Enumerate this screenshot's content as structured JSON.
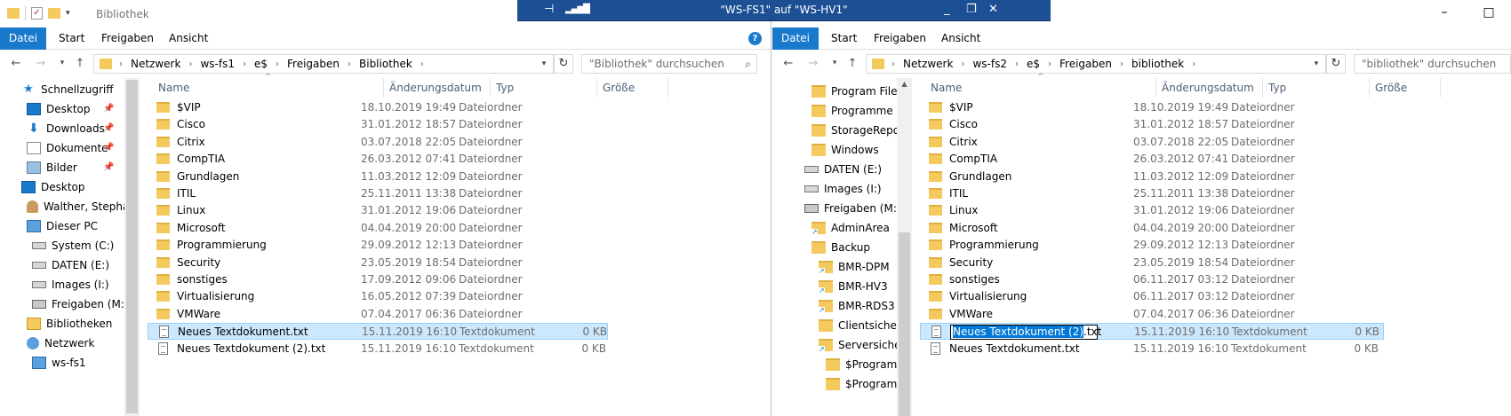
{
  "rdp_bar": {
    "title": "\"WS-FS1\" auf \"WS-HV1\""
  },
  "left": {
    "title": "Bibliothek",
    "ribbon": [
      "Datei",
      "Start",
      "Freigaben",
      "Ansicht"
    ],
    "breadcrumb": [
      "Netzwerk",
      "ws-fs1",
      "e$",
      "Freigaben",
      "Bibliothek"
    ],
    "search_placeholder": "\"Bibliothek\" durchsuchen",
    "columns": [
      "Name",
      "Änderungsdatum",
      "Typ",
      "Größe"
    ],
    "nav": [
      {
        "label": "Schnellzugriff",
        "icon": "star-icon"
      },
      {
        "label": "Desktop",
        "icon": "desktop-icon",
        "pinned": true
      },
      {
        "label": "Downloads",
        "icon": "download-icon",
        "pinned": true
      },
      {
        "label": "Dokumente",
        "icon": "documents-icon",
        "pinned": true
      },
      {
        "label": "Bilder",
        "icon": "pictures-icon",
        "pinned": true
      },
      {
        "label": "Desktop",
        "icon": "desktop-icon"
      },
      {
        "label": "Walther, Stephan",
        "icon": "user-icon"
      },
      {
        "label": "Dieser PC",
        "icon": "computer-icon"
      },
      {
        "label": "System (C:)",
        "icon": "drive-icon"
      },
      {
        "label": "DATEN (E:)",
        "icon": "drive-icon"
      },
      {
        "label": "Images (I:)",
        "icon": "drive-icon"
      },
      {
        "label": "Freigaben (M:)",
        "icon": "network-drive-icon"
      },
      {
        "label": "Bibliotheken",
        "icon": "libraries-icon"
      },
      {
        "label": "Netzwerk",
        "icon": "network-icon"
      },
      {
        "label": "ws-fs1",
        "icon": "computer-icon"
      }
    ],
    "files": [
      {
        "name": "$VIP",
        "date": "18.10.2019 19:49",
        "type": "Dateiordner",
        "size": "",
        "kind": "folder"
      },
      {
        "name": "Cisco",
        "date": "31.01.2012 18:57",
        "type": "Dateiordner",
        "size": "",
        "kind": "folder"
      },
      {
        "name": "Citrix",
        "date": "03.07.2018 22:05",
        "type": "Dateiordner",
        "size": "",
        "kind": "folder"
      },
      {
        "name": "CompTIA",
        "date": "26.03.2012 07:41",
        "type": "Dateiordner",
        "size": "",
        "kind": "folder"
      },
      {
        "name": "Grundlagen",
        "date": "11.03.2012 12:09",
        "type": "Dateiordner",
        "size": "",
        "kind": "folder"
      },
      {
        "name": "ITIL",
        "date": "25.11.2011 13:38",
        "type": "Dateiordner",
        "size": "",
        "kind": "folder"
      },
      {
        "name": "Linux",
        "date": "31.01.2012 19:06",
        "type": "Dateiordner",
        "size": "",
        "kind": "folder"
      },
      {
        "name": "Microsoft",
        "date": "04.04.2019 20:00",
        "type": "Dateiordner",
        "size": "",
        "kind": "folder"
      },
      {
        "name": "Programmierung",
        "date": "29.09.2012 12:13",
        "type": "Dateiordner",
        "size": "",
        "kind": "folder"
      },
      {
        "name": "Security",
        "date": "23.05.2019 18:54",
        "type": "Dateiordner",
        "size": "",
        "kind": "folder"
      },
      {
        "name": "sonstiges",
        "date": "17.09.2012 09:06",
        "type": "Dateiordner",
        "size": "",
        "kind": "folder"
      },
      {
        "name": "Virtualisierung",
        "date": "16.05.2012 07:39",
        "type": "Dateiordner",
        "size": "",
        "kind": "folder"
      },
      {
        "name": "VMWare",
        "date": "07.04.2017 06:36",
        "type": "Dateiordner",
        "size": "",
        "kind": "folder"
      },
      {
        "name": "Neues Textdokument.txt",
        "date": "15.11.2019 16:10",
        "type": "Textdokument",
        "size": "0 KB",
        "kind": "text",
        "selected": true
      },
      {
        "name": "Neues Textdokument (2).txt",
        "date": "15.11.2019 16:10",
        "type": "Textdokument",
        "size": "0 KB",
        "kind": "text"
      }
    ]
  },
  "right": {
    "ribbon": [
      "Datei",
      "Start",
      "Freigaben",
      "Ansicht"
    ],
    "breadcrumb": [
      "Netzwerk",
      "ws-fs2",
      "e$",
      "Freigaben",
      "bibliothek"
    ],
    "search_placeholder": "\"bibliothek\" durchsuchen",
    "columns": [
      "Name",
      "Änderungsdatum",
      "Typ",
      "Größe"
    ],
    "nav": [
      {
        "label": "Program Files",
        "icon": "folder-icon",
        "indent": 2
      },
      {
        "label": "Programme",
        "icon": "folder-icon",
        "indent": 2
      },
      {
        "label": "StorageReports",
        "icon": "folder-icon",
        "indent": 2
      },
      {
        "label": "Windows",
        "icon": "folder-icon",
        "indent": 2
      },
      {
        "label": "DATEN (E:)",
        "icon": "drive-icon",
        "indent": 1
      },
      {
        "label": "Images (I:)",
        "icon": "drive-icon",
        "indent": 1
      },
      {
        "label": "Freigaben (M:)",
        "icon": "network-drive-icon",
        "indent": 1
      },
      {
        "label": "AdminArea",
        "icon": "shortcut-folder-icon",
        "indent": 2
      },
      {
        "label": "Backup",
        "icon": "folder-icon",
        "indent": 2
      },
      {
        "label": "BMR-DPM",
        "icon": "shortcut-folder-icon",
        "indent": 3
      },
      {
        "label": "BMR-HV3",
        "icon": "shortcut-folder-icon",
        "indent": 3
      },
      {
        "label": "BMR-RDS3",
        "icon": "shortcut-folder-icon",
        "indent": 3
      },
      {
        "label": "Clientsicherung",
        "icon": "folder-icon",
        "indent": 3
      },
      {
        "label": "Serversicherung",
        "icon": "shortcut-folder-icon",
        "indent": 3
      },
      {
        "label": "$Programm",
        "icon": "folder-icon",
        "indent": 4
      },
      {
        "label": "$Programm",
        "icon": "folder-icon",
        "indent": 4
      }
    ],
    "files": [
      {
        "name": "$VIP",
        "date": "18.10.2019 19:49",
        "type": "Dateiordner",
        "size": "",
        "kind": "folder"
      },
      {
        "name": "Cisco",
        "date": "31.01.2012 18:57",
        "type": "Dateiordner",
        "size": "",
        "kind": "folder"
      },
      {
        "name": "Citrix",
        "date": "03.07.2018 22:05",
        "type": "Dateiordner",
        "size": "",
        "kind": "folder"
      },
      {
        "name": "CompTIA",
        "date": "26.03.2012 07:41",
        "type": "Dateiordner",
        "size": "",
        "kind": "folder"
      },
      {
        "name": "Grundlagen",
        "date": "11.03.2012 12:09",
        "type": "Dateiordner",
        "size": "",
        "kind": "folder"
      },
      {
        "name": "ITIL",
        "date": "25.11.2011 13:38",
        "type": "Dateiordner",
        "size": "",
        "kind": "folder"
      },
      {
        "name": "Linux",
        "date": "31.01.2012 19:06",
        "type": "Dateiordner",
        "size": "",
        "kind": "folder"
      },
      {
        "name": "Microsoft",
        "date": "04.04.2019 20:00",
        "type": "Dateiordner",
        "size": "",
        "kind": "folder"
      },
      {
        "name": "Programmierung",
        "date": "29.09.2012 12:13",
        "type": "Dateiordner",
        "size": "",
        "kind": "folder"
      },
      {
        "name": "Security",
        "date": "23.05.2019 18:54",
        "type": "Dateiordner",
        "size": "",
        "kind": "folder"
      },
      {
        "name": "sonstiges",
        "date": "06.11.2017 03:12",
        "type": "Dateiordner",
        "size": "",
        "kind": "folder"
      },
      {
        "name": "Virtualisierung",
        "date": "06.11.2017 03:12",
        "type": "Dateiordner",
        "size": "",
        "kind": "folder"
      },
      {
        "name": "VMWare",
        "date": "07.04.2017 06:36",
        "type": "Dateiordner",
        "size": "",
        "kind": "folder"
      },
      {
        "name": "Neues Textdokument (2)",
        "name_suffix": ".txt",
        "date": "15.11.2019 16:10",
        "type": "Textdokument",
        "size": "0 KB",
        "kind": "text",
        "selected": true,
        "renaming": true
      },
      {
        "name": "Neues Textdokument.txt",
        "date": "15.11.2019 16:10",
        "type": "Textdokument",
        "size": "0 KB",
        "kind": "text"
      }
    ]
  }
}
